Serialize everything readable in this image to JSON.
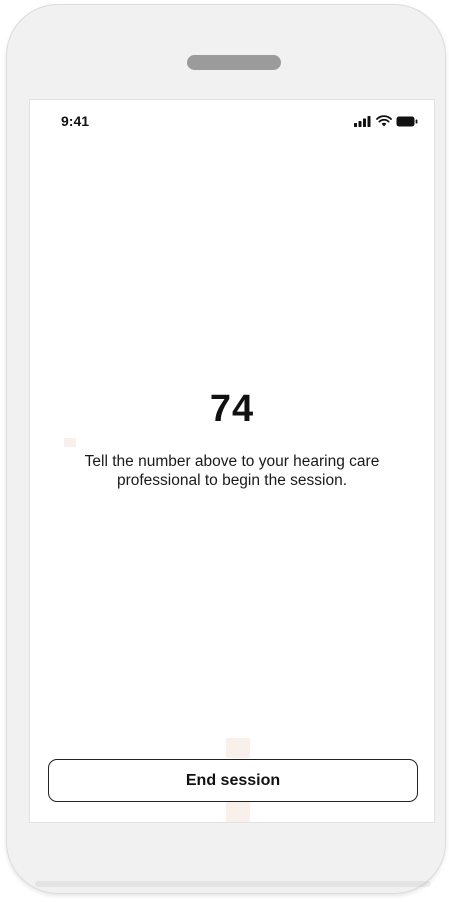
{
  "status_bar": {
    "time": "9:41",
    "icons": [
      "signal-icon",
      "wifi-icon",
      "battery-icon"
    ]
  },
  "session": {
    "code": "74",
    "instruction": "Tell the number above to your hearing care professional to begin the session."
  },
  "actions": {
    "end_session_label": "End session"
  },
  "colors": {
    "text": "#111111",
    "frame": "#f1f1f1",
    "speaker": "#9b9b9b"
  }
}
